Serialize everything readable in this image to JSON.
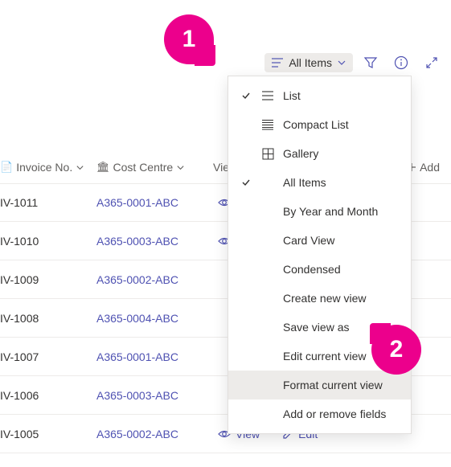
{
  "toolbar": {
    "view_switcher_label": "All Items"
  },
  "columns": {
    "invoice": "Invoice No.",
    "cost_centre": "Cost Centre",
    "view": "View",
    "add": "Add"
  },
  "rows": [
    {
      "invoice": "IV-1011",
      "cost_centre": "A365-0001-ABC"
    },
    {
      "invoice": "IV-1010",
      "cost_centre": "A365-0003-ABC"
    },
    {
      "invoice": "IV-1009",
      "cost_centre": "A365-0002-ABC"
    },
    {
      "invoice": "IV-1008",
      "cost_centre": "A365-0004-ABC"
    },
    {
      "invoice": "IV-1007",
      "cost_centre": "A365-0001-ABC"
    },
    {
      "invoice": "IV-1006",
      "cost_centre": "A365-0003-ABC"
    },
    {
      "invoice": "IV-1005",
      "cost_centre": "A365-0002-ABC"
    }
  ],
  "row_actions": {
    "view": "View",
    "edit": "Edit"
  },
  "menu": {
    "items": [
      {
        "label": "List",
        "icon": "list",
        "checked": true
      },
      {
        "label": "Compact List",
        "icon": "compact",
        "checked": false
      },
      {
        "label": "Gallery",
        "icon": "gallery",
        "checked": false
      },
      {
        "label": "All Items",
        "icon": "",
        "checked": true
      },
      {
        "label": "By Year and Month",
        "icon": "",
        "checked": false
      },
      {
        "label": "Card View",
        "icon": "",
        "checked": false
      },
      {
        "label": "Condensed",
        "icon": "",
        "checked": false
      },
      {
        "label": "Create new view",
        "icon": "",
        "checked": false
      },
      {
        "label": "Save view as",
        "icon": "",
        "checked": false
      },
      {
        "label": "Edit current view",
        "icon": "",
        "checked": false
      },
      {
        "label": "Format current view",
        "icon": "",
        "checked": false,
        "highlight": true
      },
      {
        "label": "Add or remove fields",
        "icon": "",
        "checked": false
      }
    ]
  },
  "callouts": {
    "one": "1",
    "two": "2"
  }
}
